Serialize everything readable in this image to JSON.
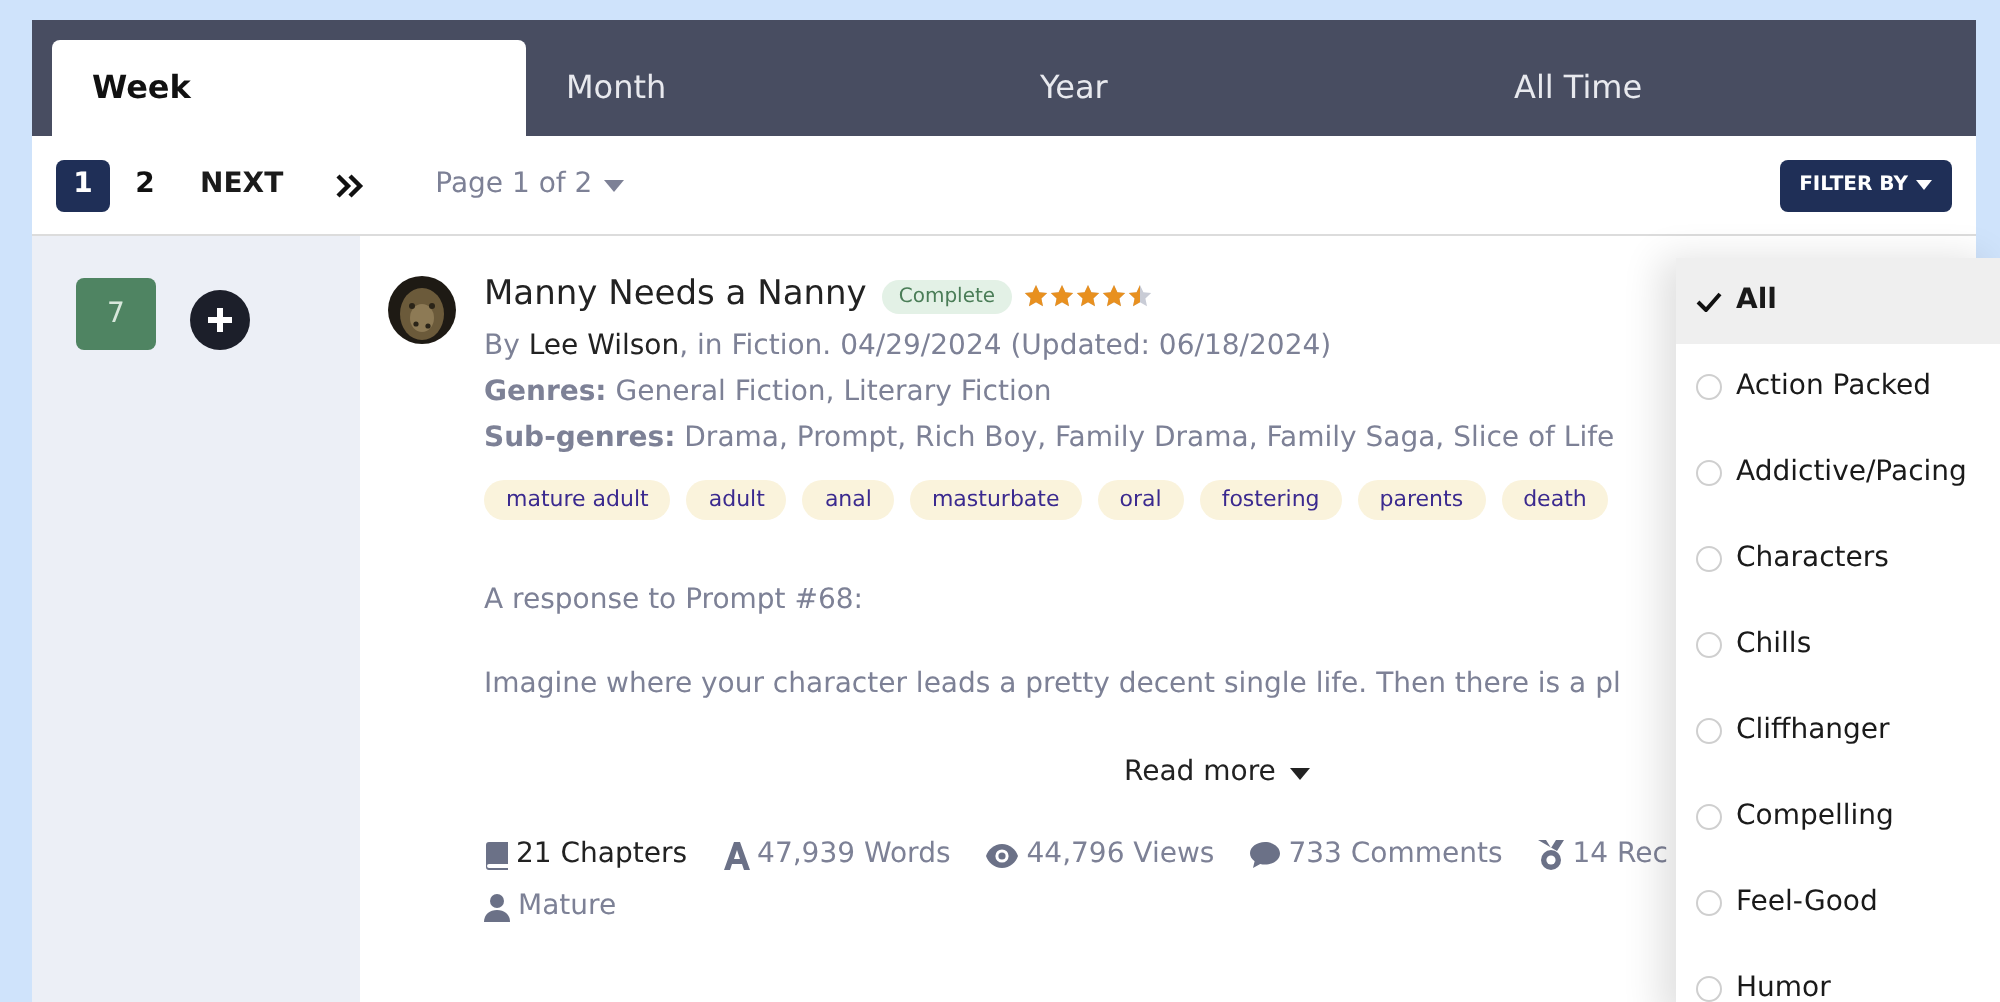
{
  "tabs": [
    {
      "label": "Week",
      "selected": true
    },
    {
      "label": "Month",
      "selected": false
    },
    {
      "label": "Year",
      "selected": false
    },
    {
      "label": "All Time",
      "selected": false
    }
  ],
  "pagination": {
    "pages": [
      {
        "label": "1",
        "selected": true
      },
      {
        "label": "2",
        "selected": false
      }
    ],
    "next": "NEXT",
    "page_select": "Page 1 of 2"
  },
  "filter_button": "FILTER BY",
  "sidebar": {
    "count": "7"
  },
  "story": {
    "title": "Manny Needs a Nanny",
    "status": "Complete",
    "stars": 4.5,
    "by": "By",
    "author": "Lee Wilson",
    "meta": ", in Fiction. 04/29/2024 (Updated: 06/18/2024)",
    "genres": "**Genres:** General Fiction, Literary Fiction",
    "subgenres": "**Sub-genres:** Drama, Prompt, Rich Boy, Family Drama, Family Saga, Slice of Life",
    "tags": [
      "mature adult",
      "adult",
      "anal",
      "masturbate",
      "oral",
      "fostering",
      "parents",
      "death"
    ],
    "excerpt": [
      "A response to Prompt #68:",
      "Imagine where your character leads a pretty decent single life. Then there is a pl"
    ],
    "read_more": "Read more",
    "stats": [
      {
        "kind": "chapters",
        "text": "21 Chapters"
      },
      {
        "kind": "words",
        "text": "47,939 Words"
      },
      {
        "kind": "views",
        "text": "44,796 Views"
      },
      {
        "kind": "comments",
        "text": "733 Comments"
      },
      {
        "kind": "recs",
        "text": "14 Rec"
      },
      {
        "kind": "rating",
        "text": "Mature"
      }
    ]
  },
  "filter_menu": [
    {
      "label": "All",
      "selected": true
    },
    {
      "label": "Action Packed",
      "selected": false
    },
    {
      "label": "Addictive/Pacing",
      "selected": false
    },
    {
      "label": "Characters",
      "selected": false
    },
    {
      "label": "Chills",
      "selected": false
    },
    {
      "label": "Cliffhanger",
      "selected": false
    },
    {
      "label": "Compelling",
      "selected": false
    },
    {
      "label": "Feel-Good",
      "selected": false
    },
    {
      "label": "Humor",
      "selected": false
    }
  ]
}
